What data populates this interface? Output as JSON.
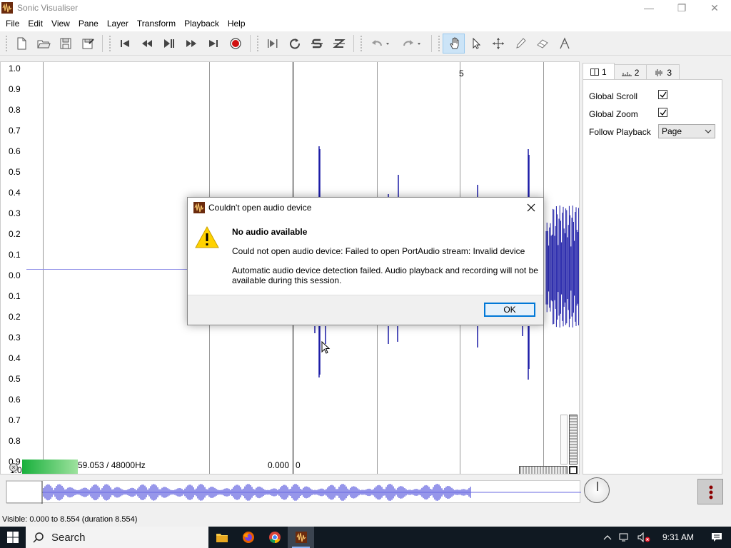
{
  "window": {
    "title": "Sonic Visualiser",
    "minimize": "—",
    "restore": "❐",
    "close": "✕"
  },
  "menu": [
    "File",
    "Edit",
    "View",
    "Pane",
    "Layer",
    "Transform",
    "Playback",
    "Help"
  ],
  "toolbar": {
    "icons": [
      "new-session",
      "open",
      "save",
      "save-as",
      "rewind-start",
      "rewind",
      "play-pause",
      "fast-forward",
      "ffwd-end",
      "record",
      "play-selection",
      "loop",
      "solo",
      "play-speed-mode",
      "undo",
      "redo",
      "navigate",
      "select",
      "move",
      "draw",
      "erase",
      "measure"
    ]
  },
  "pane": {
    "scale_labels": [
      "1.0",
      "0.9",
      "0.8",
      "0.7",
      "0.6",
      "0.5",
      "0.4",
      "0.3",
      "0.2",
      "0.1",
      "0.0",
      "0.1",
      "0.2",
      "0.3",
      "0.4",
      "0.5",
      "0.6",
      "0.7",
      "0.8",
      "0.9"
    ],
    "bottom_scale_partial": "1.0",
    "marker_5": "5",
    "sample_rate_info": "59.053 / 48000Hz",
    "position_info": "0.000",
    "zero_label": "0"
  },
  "properties": {
    "tabs": [
      {
        "label": "1"
      },
      {
        "label": "2"
      },
      {
        "label": "3"
      }
    ],
    "global_scroll_label": "Global Scroll",
    "global_scroll_checked": true,
    "global_zoom_label": "Global Zoom",
    "global_zoom_checked": true,
    "follow_playback_label": "Follow Playback",
    "follow_playback_value": "Page"
  },
  "status": {
    "text": "Visible: 0.000 to 8.554 (duration 8.554)"
  },
  "dialog": {
    "title": "Couldn't open audio device",
    "heading": "No audio available",
    "message1": "Could not open audio device: Failed to open PortAudio stream: Invalid device",
    "message2": "Automatic audio device detection failed. Audio playback and recording will not be available during this session.",
    "ok_label": "OK"
  },
  "taskbar": {
    "search_label": "Search",
    "time": "9:31 AM"
  },
  "colors": {
    "waveform": "#1a1aa6",
    "overview_wave": "#6a6ae0",
    "accent": "#0078d7"
  }
}
